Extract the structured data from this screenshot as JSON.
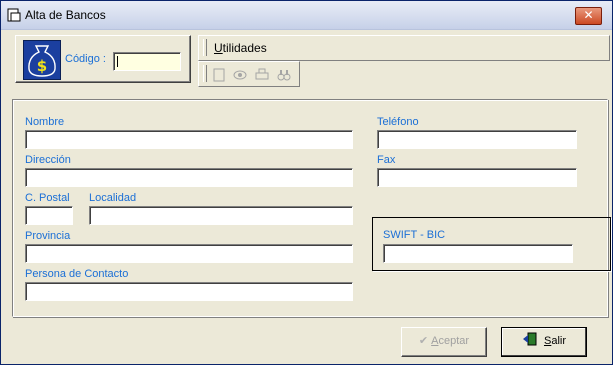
{
  "window": {
    "title": "Alta de Bancos",
    "close_glyph": "✕"
  },
  "codigo": {
    "label": "Código :",
    "value": ""
  },
  "utilidades": {
    "label_first": "U",
    "label_rest": "tilidades"
  },
  "toolbar_icons": [
    "new-document-icon",
    "view-icon",
    "print-icon",
    "search-binoculars-icon"
  ],
  "form": {
    "nombre": {
      "label": "Nombre",
      "value": ""
    },
    "telefono": {
      "label": "Teléfono",
      "value": ""
    },
    "direccion": {
      "label": "Dirección",
      "value": ""
    },
    "fax": {
      "label": "Fax",
      "value": ""
    },
    "cpostal": {
      "label": "C. Postal",
      "value": ""
    },
    "localidad": {
      "label": "Localidad",
      "value": ""
    },
    "provincia": {
      "label": "Provincia",
      "value": ""
    },
    "swift": {
      "label": "SWIFT - BIC",
      "value": ""
    },
    "contacto": {
      "label": "Persona de Contacto",
      "value": ""
    }
  },
  "buttons": {
    "aceptar_first": "A",
    "aceptar_rest": "ceptar",
    "salir_first": "S",
    "salir_rest": "alir"
  },
  "colors": {
    "label_blue": "#1b6fd6",
    "codigo_bg": "#ffffe1",
    "bag_blue": "#1b3f9f"
  }
}
